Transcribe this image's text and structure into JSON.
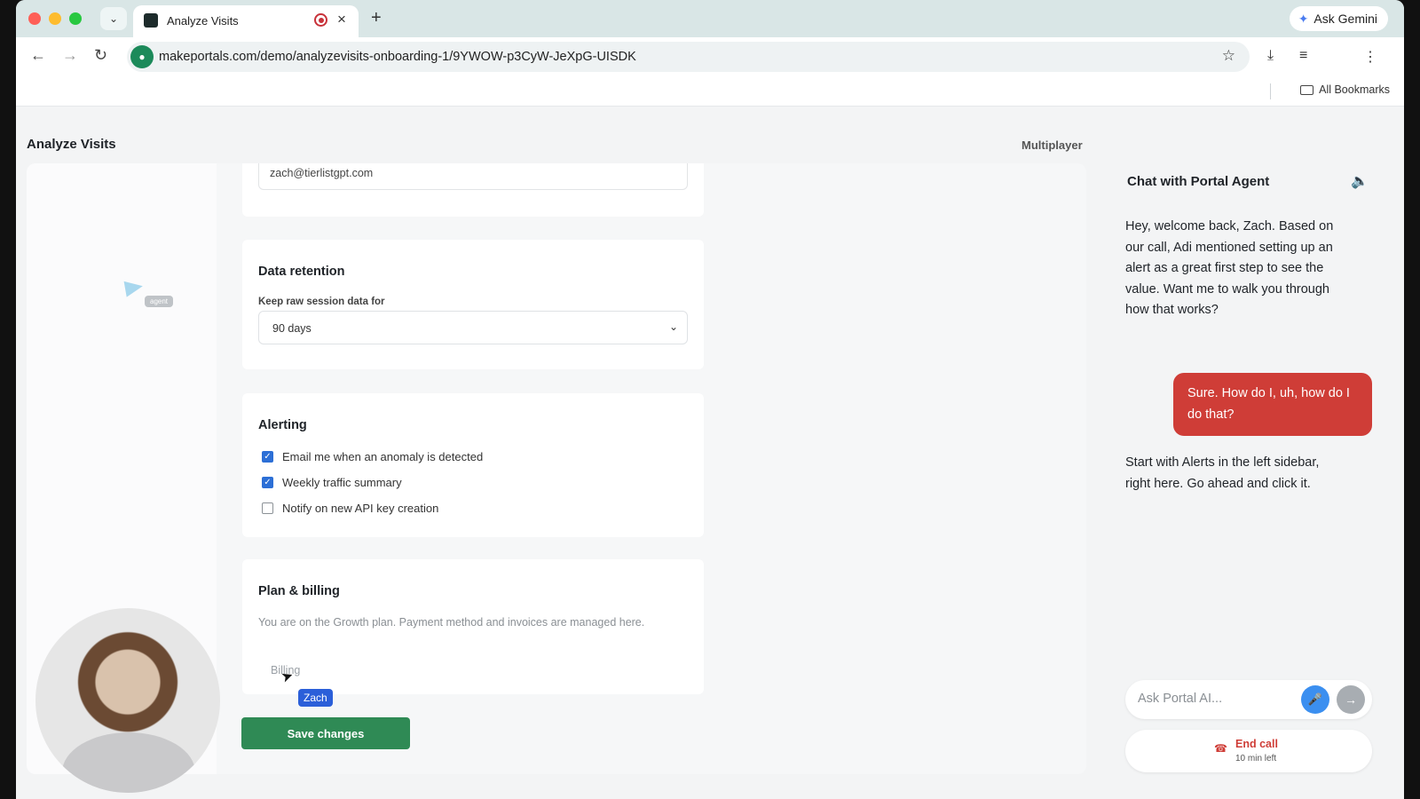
{
  "browser": {
    "tab_title": "Analyze Visits",
    "url": "makeportals.com/demo/analyzevisits-onboarding-1/9YWOW-p3CyW-JeXpG-UISDK",
    "gemini_label": "Ask Gemini",
    "bookmarks_label": "All Bookmarks"
  },
  "page": {
    "title": "Analyze Visits",
    "multiplayer": "Multiplayer"
  },
  "account": {
    "email_value": "zach@tierlistgpt.com"
  },
  "retention": {
    "heading": "Data retention",
    "label": "Keep raw session data for",
    "selected": "90 days"
  },
  "alerting": {
    "heading": "Alerting",
    "options": [
      {
        "label": "Email me when an anomaly is detected",
        "checked": true
      },
      {
        "label": "Weekly traffic summary",
        "checked": true
      },
      {
        "label": "Notify on new API key creation",
        "checked": false
      }
    ]
  },
  "plan": {
    "heading": "Plan & billing",
    "description": "You are on the Growth plan. Payment method and invoices are managed here.",
    "billing_link": "Billing"
  },
  "cursors": {
    "agent_tag": "agent",
    "user_tag": "Zach"
  },
  "actions": {
    "save_label": "Save changes"
  },
  "chat": {
    "title": "Chat with Portal Agent",
    "messages": [
      {
        "role": "agent",
        "text": "Hey, welcome back, Zach. Based on our call, Adi mentioned setting up an alert as a great first step to see the value. Want me to walk you through how that works?"
      },
      {
        "role": "user",
        "text": "Sure. How do I, uh, how do I do that?"
      },
      {
        "role": "agent",
        "text": "Start with Alerts in the left sidebar, right here. Go ahead and click it."
      }
    ],
    "input_placeholder": "Ask Portal AI...",
    "end_call_label": "End call",
    "end_call_sub": "10 min left"
  },
  "colors": {
    "accent_green": "#2f8a55",
    "user_bubble": "#cf3d37",
    "mic_blue": "#3b8ff0",
    "checkbox_blue": "#2c6fd6"
  }
}
